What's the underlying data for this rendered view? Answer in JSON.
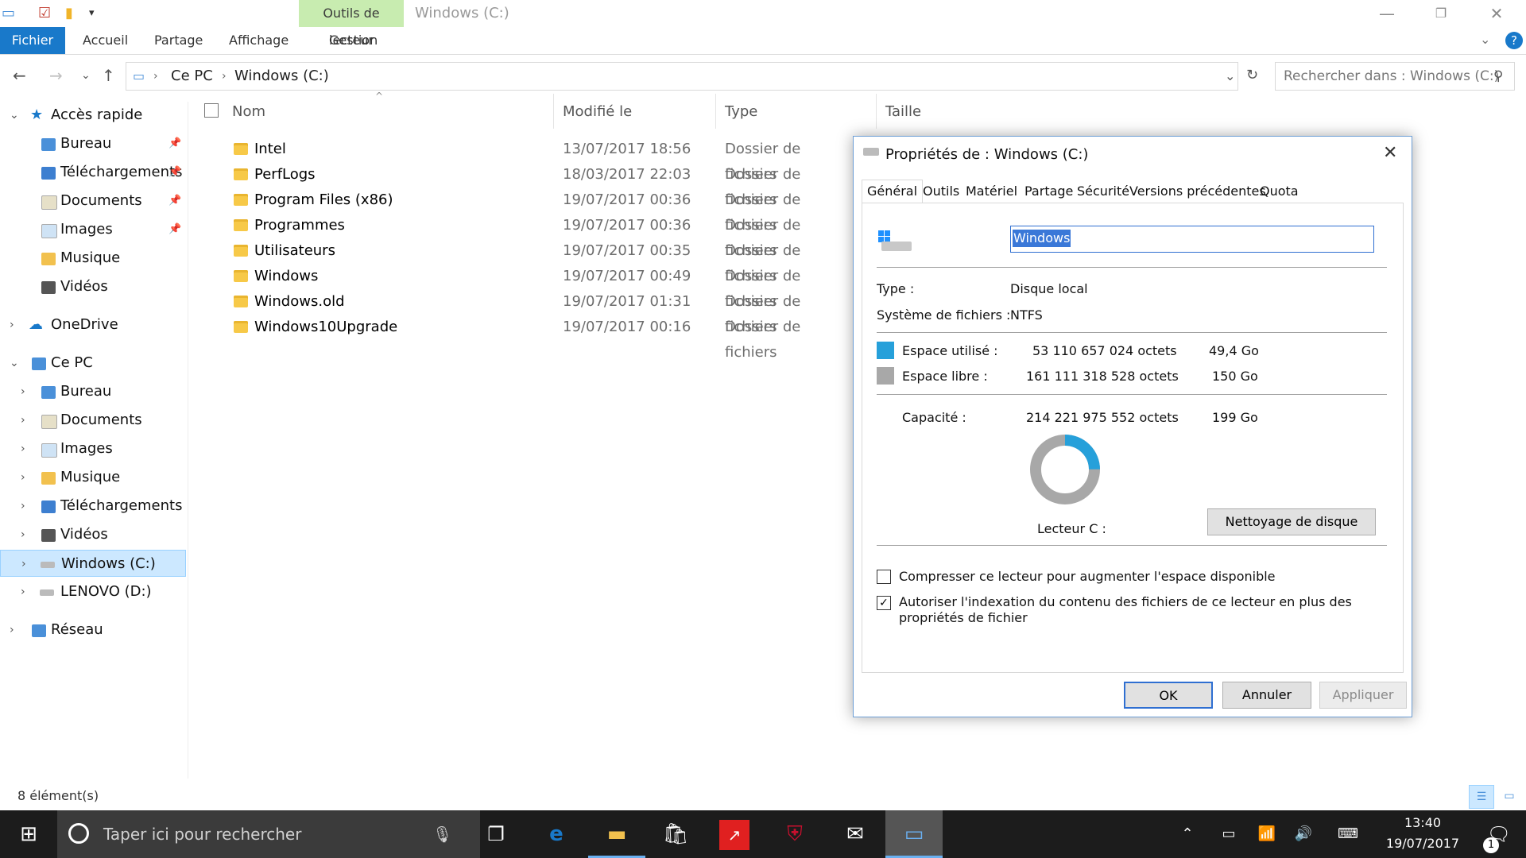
{
  "window": {
    "context_tab": "Outils de lecteur",
    "title": "Windows (C:)"
  },
  "ribbon": {
    "tabs": [
      "Fichier",
      "Accueil",
      "Partage",
      "Affichage",
      "Gestion"
    ]
  },
  "address": {
    "crumbs": [
      "Ce PC",
      "Windows (C:)"
    ],
    "search_placeholder": "Rechercher dans : Windows (C:)"
  },
  "nav": {
    "quick_access": "Accès rapide",
    "quick_items": [
      "Bureau",
      "Téléchargements",
      "Documents",
      "Images",
      "Musique",
      "Vidéos"
    ],
    "onedrive": "OneDrive",
    "this_pc": "Ce PC",
    "pc_items": [
      "Bureau",
      "Documents",
      "Images",
      "Musique",
      "Téléchargements",
      "Vidéos",
      "Windows (C:)",
      "LENOVO (D:)"
    ],
    "network": "Réseau"
  },
  "files": {
    "headers": [
      "Nom",
      "Modifié le",
      "Type",
      "Taille"
    ],
    "rows": [
      {
        "name": "Intel",
        "date": "13/07/2017 18:56",
        "type": "Dossier de fichiers"
      },
      {
        "name": "PerfLogs",
        "date": "18/03/2017 22:03",
        "type": "Dossier de fichiers"
      },
      {
        "name": "Program Files (x86)",
        "date": "19/07/2017 00:36",
        "type": "Dossier de fichiers"
      },
      {
        "name": "Programmes",
        "date": "19/07/2017 00:36",
        "type": "Dossier de fichiers"
      },
      {
        "name": "Utilisateurs",
        "date": "19/07/2017 00:35",
        "type": "Dossier de fichiers"
      },
      {
        "name": "Windows",
        "date": "19/07/2017 00:49",
        "type": "Dossier de fichiers"
      },
      {
        "name": "Windows.old",
        "date": "19/07/2017 01:31",
        "type": "Dossier de fichiers"
      },
      {
        "name": "Windows10Upgrade",
        "date": "19/07/2017 00:16",
        "type": "Dossier de fichiers"
      }
    ]
  },
  "dialog": {
    "title": "Propriétés de : Windows (C:)",
    "tabs": [
      "Général",
      "Outils",
      "Matériel",
      "Partage",
      "Sécurité",
      "Versions précédentes",
      "Quota"
    ],
    "name_value": "Windows",
    "type_label": "Type :",
    "type_value": "Disque local",
    "fs_label": "Système de fichiers :",
    "fs_value": "NTFS",
    "used_label": "Espace utilisé :",
    "used_bytes": "53 110 657 024 octets",
    "used_size": "49,4 Go",
    "free_label": "Espace libre :",
    "free_bytes": "161 111 318 528 octets",
    "free_size": "150 Go",
    "capacity_label": "Capacité :",
    "capacity_bytes": "214 221 975 552 octets",
    "capacity_size": "199 Go",
    "drive_label": "Lecteur C :",
    "cleanup_button": "Nettoyage de disque",
    "compress_label": "Compresser ce lecteur pour augmenter l'espace disponible",
    "compress_checked": false,
    "index_label": "Autoriser l'indexation du contenu des fichiers de ce lecteur en plus des propriétés de fichier",
    "index_checked": true,
    "ok": "OK",
    "cancel": "Annuler",
    "apply": "Appliquer",
    "used_fraction": 0.248,
    "used_color": "#26a0da",
    "free_color": "#a8a8a8"
  },
  "status": {
    "count": "8 élément(s)"
  },
  "taskbar": {
    "search_placeholder": "Taper ici pour rechercher",
    "time": "13:40",
    "date": "19/07/2017",
    "notification_count": "1"
  }
}
